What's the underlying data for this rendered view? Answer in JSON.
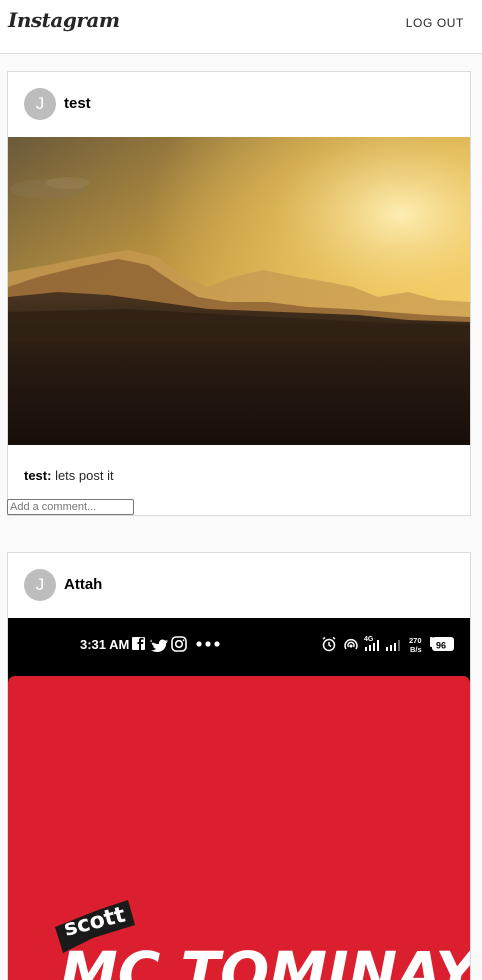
{
  "header": {
    "logo_text": "Instagram",
    "logout_label": "LOG OUT"
  },
  "posts": [
    {
      "username": "test",
      "avatar_initial": "J",
      "caption_user": "test:",
      "caption_text": " lets post it",
      "comment_placeholder": "Add a comment...",
      "image": "desert-sunset-photo"
    },
    {
      "username": "Attah",
      "avatar_initial": "J",
      "image": "phone-screenshot",
      "status_bar": {
        "time": "3:31 AM",
        "network": "4G",
        "speed_value": "270",
        "speed_unit": "B/s",
        "battery": "96"
      },
      "artwork_text_top": "scott",
      "artwork_text_main": "MC TOMINAY"
    }
  ],
  "colors": {
    "border": "#dbdbdb",
    "page_bg": "#fafafa",
    "poster_red": "#db1f2e"
  }
}
